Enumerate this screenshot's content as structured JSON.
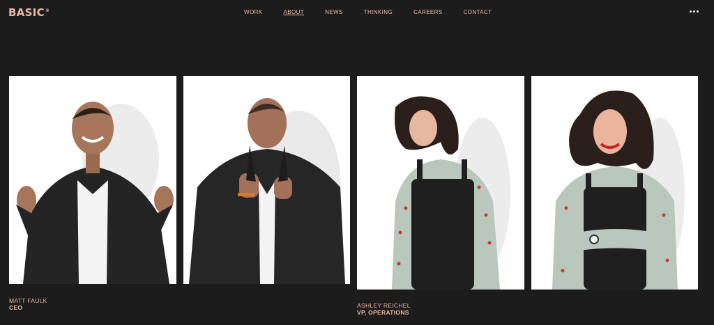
{
  "brand": {
    "logo_text": "BASIC",
    "logo_mark": "®"
  },
  "nav": {
    "items": [
      {
        "label": "WORK"
      },
      {
        "label": "ABOUT"
      },
      {
        "label": "NEWS"
      },
      {
        "label": "THINKING"
      },
      {
        "label": "CAREERS"
      },
      {
        "label": "CONTACT"
      }
    ],
    "active": "ABOUT",
    "menu_icon": "more-horizontal-icon"
  },
  "team": [
    {
      "name": "MATT FAULK",
      "role": "CEO"
    },
    {
      "name": "",
      "role": ""
    },
    {
      "name": "ASHLEY REICHEL",
      "role": "VP, OPERATIONS"
    },
    {
      "name": "",
      "role": ""
    }
  ],
  "colors": {
    "background": "#1d1c1c",
    "accent": "#e9b9a6",
    "photo_background": "#ffffff"
  }
}
